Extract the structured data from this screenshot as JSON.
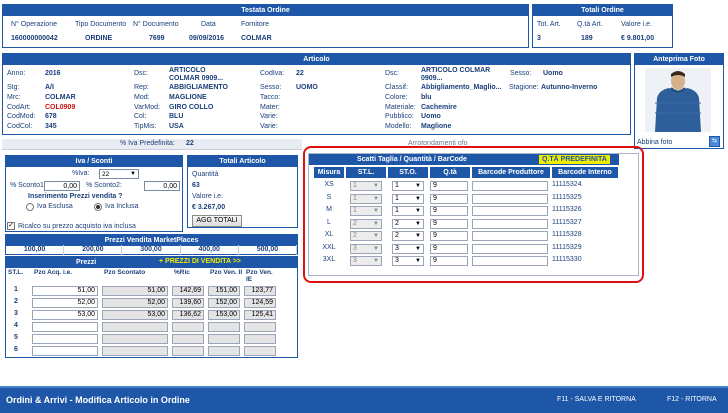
{
  "testata": {
    "title": "Testata Ordine",
    "col_num_op": "N° Operazione",
    "col_tipo": "Tipo Documento",
    "col_num_doc": "N° Documento",
    "col_data": "Data",
    "col_forn": "Fornitore",
    "num_op": "160000000042",
    "tipo": "ORDINE",
    "num_doc": "7699",
    "data": "09/09/2016",
    "fornitore": "COLMAR"
  },
  "totali_ordine": {
    "title": "Totali Ordine",
    "col_art": "Tot. Art.",
    "col_qta": "Q.tà Art.",
    "col_val": "Valore i.e.",
    "art": "3",
    "qta": "189",
    "val": "€ 9.801,00"
  },
  "articolo": {
    "title": "Articolo",
    "anno_l": "Anno:",
    "anno": "2016",
    "stg_l": "Stg:",
    "stg": "A/I",
    "mrc_l": "Mrc:",
    "mrc": "COLMAR",
    "codart_l": "CodArt:",
    "codart": "COL0909",
    "codmod_l": "CodMod:",
    "codmod": "678",
    "codcol_l": "CodCol:",
    "codcol": "345",
    "dsc_l": "Dsc:",
    "dsc": "ARTICOLO COLMAR 0909...",
    "rep_l": "Rep:",
    "rep": "ABBIGLIAMENTO",
    "mod_l": "Mod:",
    "mod": "MAGLIONE",
    "varmod_l": "VarMod:",
    "varmod": "GIRO COLLO",
    "col_l": "Col:",
    "col": "BLU",
    "tipmis_l": "TipMis:",
    "tipmis": "USA",
    "codiva_l": "CodIva:",
    "codiva": "22",
    "sesso_l": "Sesso:",
    "sesso": "UOMO",
    "tacco_l": "Tacco:",
    "tacco": "",
    "mater_l": "Mater:",
    "mater": "",
    "varie1_l": "Varie:",
    "varie1": "",
    "varie2_l": "Varie:",
    "varie2": "",
    "dsc2_l": "Dsc:",
    "dsc2": "ARTICOLO COLMAR 0909...",
    "classif_l": "Classif:",
    "classif": "Abbigliamento_Maglio...",
    "colore_l": "Colore:",
    "colore": "blu",
    "materiale_l": "Materiale:",
    "materiale": "Cachemire",
    "pubblico_l": "Pubblico:",
    "pubblico": "Uomo",
    "modello_l": "Modello:",
    "modello": "Maglione",
    "sesso2_l": "Sesso:",
    "sesso2": "Uomo",
    "stagione_l": "Stagione:",
    "stagione": "Autunno-Inverno"
  },
  "anteprima": {
    "title": "Anteprima Foto",
    "abbina": "Abbina foto"
  },
  "iva_pred": {
    "label": "% Iva Predefinita:",
    "value": "22",
    "note": "Arrotondamenti ofo"
  },
  "iva_sconti": {
    "title": "Iva / Sconti",
    "iva_l": "%Iva:",
    "iva": "22",
    "sc1_l": "% Sconto1:",
    "sc1": "0,00",
    "sc2_l": "% Sconto2:",
    "sc2": "0,00",
    "ins_l": "Inserimento Prezzi vendita ?",
    "esclusa": "Iva Esclusa",
    "inclusa": "Iva Inclusa",
    "ricalc": "Ricalco su prezzo acquisto iva inclusa"
  },
  "totali_articolo": {
    "title": "Totali Articolo",
    "qta_l": "Quantità",
    "qta": "63",
    "val_l": "Valore i.e.",
    "val": "€ 3.267,00",
    "btn": "AGG TOTALI"
  },
  "marketplaces": {
    "title": "Prezzi Vendita MarketPlaces",
    "values": [
      "100,00",
      "200,00",
      "300,00",
      "400,00",
      "500,00"
    ]
  },
  "prezzi": {
    "title": "Prezzi",
    "link": "+ PREZZI DI VENDITA >>",
    "headers": [
      "ST.L.",
      "Pzo Acq. i.e.",
      "Pzo Scontato",
      "%Ric",
      "Pzo Ven. II",
      "Pzo Ven. IE"
    ],
    "rows": [
      [
        "1",
        "51,00",
        "51,00",
        "142,69",
        "151,00",
        "123,77"
      ],
      [
        "2",
        "52,00",
        "52,00",
        "139,60",
        "152,00",
        "124,59"
      ],
      [
        "3",
        "53,00",
        "53,00",
        "136,62",
        "153,00",
        "125,41"
      ],
      [
        "4",
        "",
        "",
        "",
        "",
        ""
      ],
      [
        "5",
        "",
        "",
        "",
        "",
        ""
      ],
      [
        "6",
        "",
        "",
        "",
        "",
        ""
      ]
    ]
  },
  "scatti": {
    "title": "Scatti Taglia / Quantità / BarCode",
    "qta_pred": "Q.TÀ PREDEFINITA",
    "headers": [
      "Misura",
      "ST.L.",
      "ST.O.",
      "Q.tà",
      "Barcode Produttore",
      "Barcode Interno"
    ],
    "rows": [
      [
        "XS",
        "1",
        "1",
        "9",
        "",
        "11115324"
      ],
      [
        "S",
        "1",
        "1",
        "9",
        "",
        "11115325"
      ],
      [
        "M",
        "1",
        "1",
        "9",
        "",
        "11115326"
      ],
      [
        "L",
        "2",
        "2",
        "9",
        "",
        "11115327"
      ],
      [
        "XL",
        "2",
        "2",
        "9",
        "",
        "11115328"
      ],
      [
        "XXL",
        "3",
        "3",
        "9",
        "",
        "11115329"
      ],
      [
        "3XL",
        "3",
        "3",
        "9",
        "",
        "11115330"
      ]
    ]
  },
  "footer": {
    "title": "Ordini & Arrivi - Modifica Articolo in Ordine",
    "f11": "F11 - SALVA E RITORNA",
    "f12": "F12 - RITORNA"
  },
  "colors": {
    "header": "#1e57a8",
    "highlight": "#e01010",
    "yellow": "#f0ec00"
  }
}
